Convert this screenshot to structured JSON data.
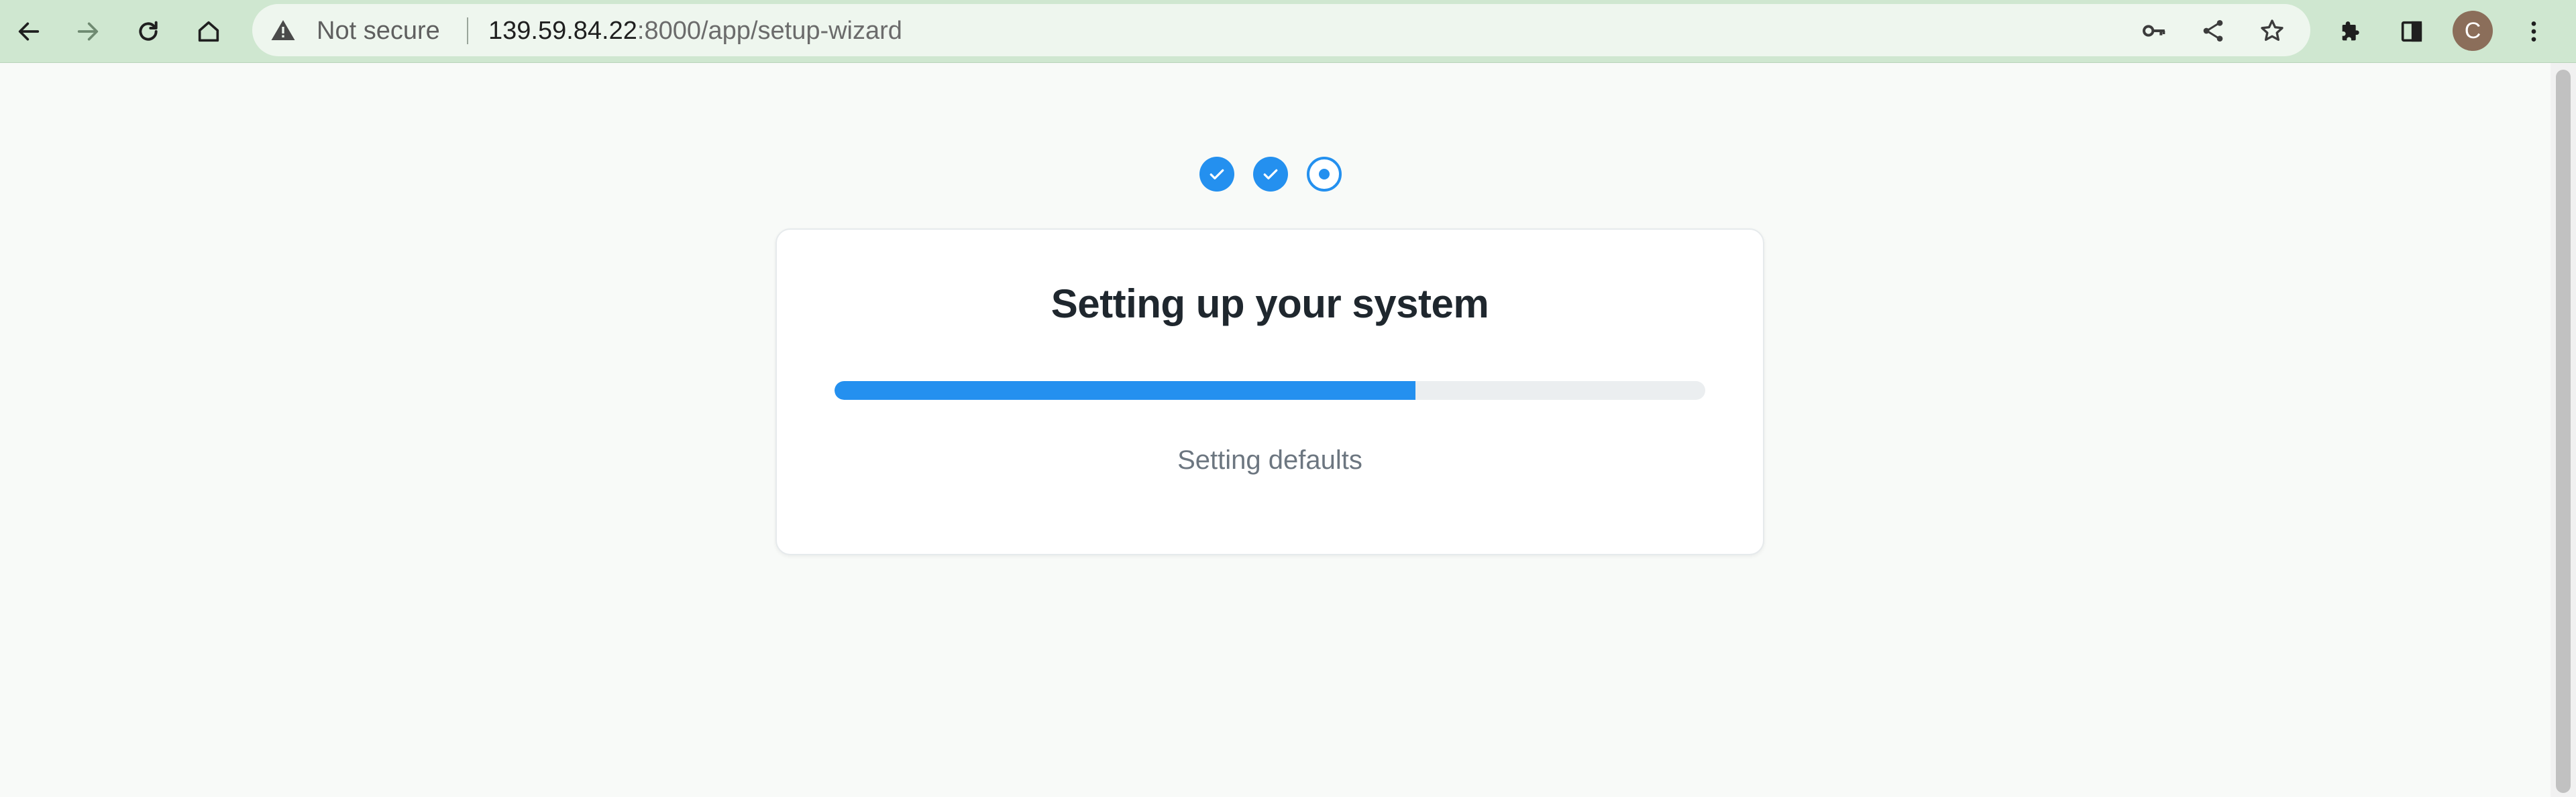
{
  "browser": {
    "security_label": "Not secure",
    "url_host": "139.59.84.22",
    "url_rest": ":8000/app/setup-wizard",
    "profile_initial": "C",
    "icons": [
      "back-icon",
      "forward-icon",
      "reload-icon",
      "home-icon",
      "warning-icon",
      "key-icon",
      "share-icon",
      "star-icon",
      "extensions-icon",
      "side-panel-icon",
      "menu-icon"
    ]
  },
  "wizard": {
    "steps": [
      {
        "state": "done"
      },
      {
        "state": "done"
      },
      {
        "state": "current"
      }
    ],
    "title": "Setting up your system",
    "progress_fraction": 0.667,
    "status": "Setting defaults",
    "accent_color": "#2490ef"
  }
}
